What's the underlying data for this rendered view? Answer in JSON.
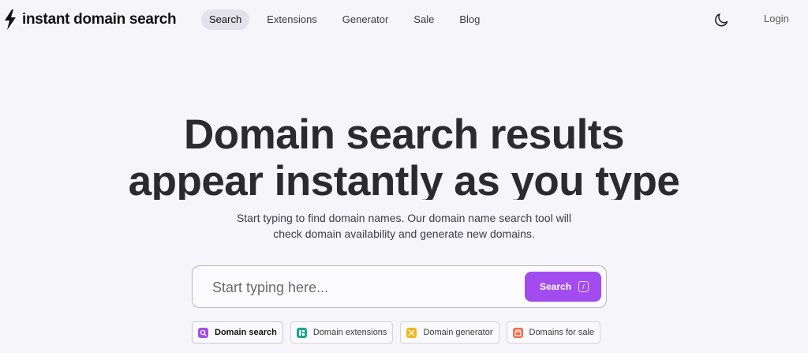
{
  "header": {
    "brand": "instant domain search",
    "nav": [
      {
        "label": "Search",
        "active": true
      },
      {
        "label": "Extensions",
        "active": false
      },
      {
        "label": "Generator",
        "active": false
      },
      {
        "label": "Sale",
        "active": false
      },
      {
        "label": "Blog",
        "active": false
      }
    ],
    "theme_icon": "moon-icon",
    "login_label": "Login"
  },
  "hero": {
    "title_line1": "Domain search results",
    "title_line2": "appear instantly as you type",
    "subtitle_line1": "Start typing to find domain names. Our domain name search tool will",
    "subtitle_line2": "check domain availability and generate new domains."
  },
  "search": {
    "placeholder": "Start typing here...",
    "value": "",
    "button_label": "Search",
    "shortcut_key": "/"
  },
  "chips": [
    {
      "label": "Domain search",
      "icon": "search-icon",
      "color": "#a24cf0",
      "active": true
    },
    {
      "label": "Domain extensions",
      "icon": "extensions-icon",
      "color": "#1fa58c",
      "active": false
    },
    {
      "label": "Domain generator",
      "icon": "shuffle-icon",
      "color": "#f0b71c",
      "active": false
    },
    {
      "label": "Domains for sale",
      "icon": "store-icon",
      "color": "#ef6d4a",
      "active": false
    }
  ],
  "colors": {
    "accent": "#a24cf0",
    "background": "#f6f5fa",
    "text": "#2a2a2f"
  }
}
